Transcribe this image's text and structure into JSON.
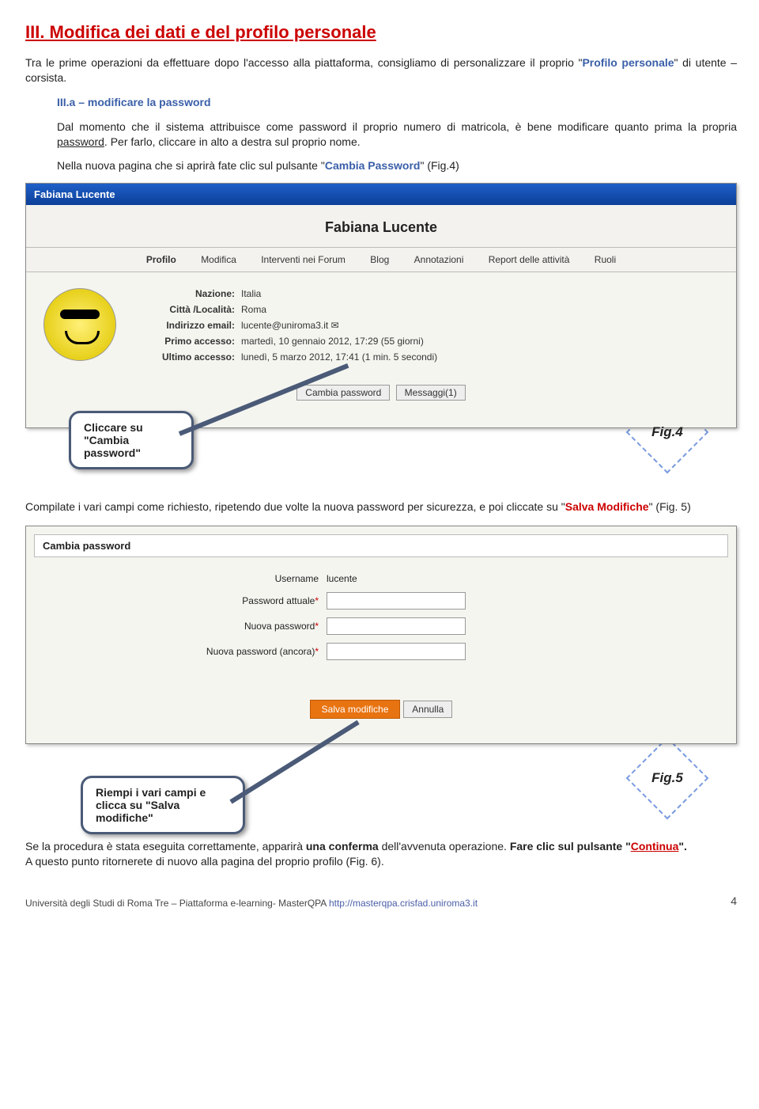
{
  "heading": "III.  Modifica dei dati e del profilo personale",
  "intro": {
    "p1_a": "Tra le prime operazioni da effettuare dopo l'accesso alla piattaforma, consigliamo di personalizzare il proprio \"",
    "p1_b": "Profilo personale",
    "p1_c": "\" di utente – corsista."
  },
  "sub_a": {
    "title": "III.a – modificare la password",
    "p_a": "Dal momento che il sistema attribuisce come password il proprio numero di matricola, è bene modificare quanto prima la propria ",
    "p_pw": "password",
    "p_b": ". Per farlo, cliccare in alto a destra sul proprio nome.",
    "p2_a": "Nella nuova pagina che si aprirà fate clic sul pulsante \"",
    "p2_b": "Cambia Password",
    "p2_c": "\" (Fig.4)"
  },
  "shot1": {
    "titlebar": "Fabiana Lucente",
    "name_big": "Fabiana Lucente",
    "tabs": [
      "Profilo",
      "Modifica",
      "Interventi nei Forum",
      "Blog",
      "Annotazioni",
      "Report delle attività",
      "Ruoli"
    ],
    "rows": {
      "nazione_l": "Nazione:",
      "nazione_v": "Italia",
      "citta_l": "Città /Località:",
      "citta_v": "Roma",
      "email_l": "Indirizzo email:",
      "email_v": "lucente@uniroma3.it ✉",
      "primo_l": "Primo accesso:",
      "primo_v": "martedì, 10 gennaio 2012, 17:29  (55 giorni)",
      "ultimo_l": "Ultimo accesso:",
      "ultimo_v": "lunedì, 5 marzo 2012, 17:41  (1 min. 5 secondi)"
    },
    "btn_cambia": "Cambia password",
    "btn_msg": "Messaggi(1)"
  },
  "callout1": "Cliccare su \"Cambia password\"",
  "fig4": "Fig.4",
  "mid": {
    "a": "Compilate i vari campi come richiesto, ripetendo due volte la nuova password per sicurezza, e poi cliccate su \"",
    "b": "Salva Modifiche",
    "c": "\" (Fig. 5)"
  },
  "shot2": {
    "box_title": "Cambia password",
    "user_l": "Username",
    "user_v": "lucente",
    "cur_l": "Password attuale",
    "new_l": "Nuova password",
    "again_l": "Nuova password (ancora)",
    "save": "Salva modifiche",
    "cancel": "Annulla"
  },
  "callout2": "Riempi i vari campi e clicca su \"Salva modifiche\"",
  "fig5": "Fig.5",
  "closing": {
    "a": "Se la procedura è stata eseguita correttamente, apparirà ",
    "b": "una conferma",
    "c": " dell'avvenuta operazione. ",
    "d": "Fare clic sul pulsante \"",
    "e": "Continua",
    "f": "\".",
    "g": "A questo punto ritornerete di nuovo alla pagina del proprio profilo (Fig. 6)."
  },
  "footer": {
    "text": "Università degli Studi di Roma Tre – Piattaforma e-learning- MasterQPA ",
    "url": "http://masterqpa.crisfad.uniroma3.it"
  },
  "page": "4"
}
